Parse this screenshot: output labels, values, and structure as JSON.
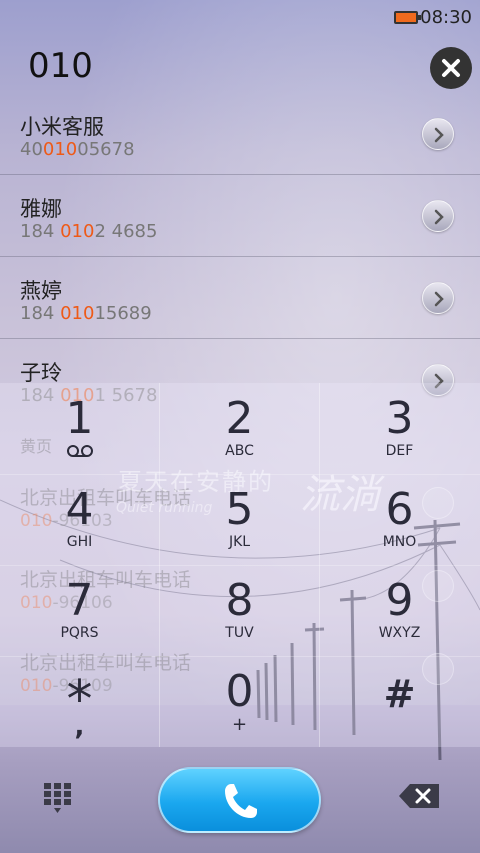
{
  "status_bar": {
    "time": "08:30",
    "battery_color": "#f06a1e"
  },
  "dialer": {
    "input": "010"
  },
  "contacts": [
    {
      "name": "小米客服",
      "number_pre": "40",
      "number_match": "010",
      "number_post": "05678"
    },
    {
      "name": "雅娜",
      "number_pre": "184 ",
      "number_match": "010",
      "number_post": "2 4685"
    },
    {
      "name": "燕婷",
      "number_pre": "184 ",
      "number_match": "010",
      "number_post": "15689"
    },
    {
      "name": "子玲",
      "number_pre": "184 ",
      "number_match": "010",
      "number_post": "1 5678"
    }
  ],
  "behind_list": {
    "section_label": "黄页",
    "items": [
      {
        "name": "北京出租车叫车电话",
        "number_match": "010",
        "number_post": "-96103"
      },
      {
        "name": "北京出租车叫车电话",
        "number_match": "010",
        "number_post": "-96106"
      },
      {
        "name": "北京出租车叫车电话",
        "number_match": "010",
        "number_post": "-96109"
      }
    ]
  },
  "wallpaper": {
    "text_cn": "夏天在安静的",
    "text_en": "Quiet running",
    "text_script": "流淌"
  },
  "keypad": {
    "keys": [
      {
        "num": "1",
        "sub": "",
        "icon": "voicemail-icon"
      },
      {
        "num": "2",
        "sub": "ABC"
      },
      {
        "num": "3",
        "sub": "DEF"
      },
      {
        "num": "4",
        "sub": "GHI"
      },
      {
        "num": "5",
        "sub": "JKL"
      },
      {
        "num": "6",
        "sub": "MNO"
      },
      {
        "num": "7",
        "sub": "PQRS"
      },
      {
        "num": "8",
        "sub": "TUV"
      },
      {
        "num": "9",
        "sub": "WXYZ"
      },
      {
        "num": "*",
        "sub": ","
      },
      {
        "num": "0",
        "sub": "+"
      },
      {
        "num": "#",
        "sub": ""
      }
    ]
  },
  "colors": {
    "accent": "#ee5a17",
    "call_button": "#1aa7ef"
  }
}
